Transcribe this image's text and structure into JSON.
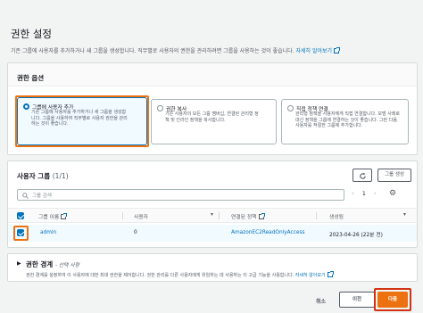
{
  "page": {
    "title": "권한 설정",
    "description": "기존 그룹에 사용자를 추가하거나 새 그룹을 생성합니다. 직무별로 사용자의 권한을 관리하려면 그룹을 사용하는 것이 좋습니다.",
    "learn_more": "자세히 알아보기"
  },
  "permission_options": {
    "header": "권한 옵션",
    "options": [
      {
        "label": "그룹에 사용자 추가",
        "desc": "기존 그룹에 사용자를 추가하거나 새 그룹을 생성합니다. 그룹을 사용하여 직무별로 사용자 권한을 관리하는 것이 좋습니다.",
        "selected": true
      },
      {
        "label": "권한 복사",
        "desc": "기존 사용자의 모든 그룹 멤버십, 연결된 관리형 정책 및 인라인 정책을 복사합니다.",
        "selected": false
      },
      {
        "label": "직접 정책 연결",
        "desc": "관리형 정책을 사용자에게 직접 연결합니다. 모범 사례로 대신 정책을 그룹에 연결하는 것이 좋습니다. 그런 다음 사용자를 적절한 그룹에 추가합니다.",
        "selected": false
      }
    ]
  },
  "user_groups": {
    "header": "사용자 그룹",
    "count": "(1/1)",
    "create_button": "그룹 생성",
    "search_placeholder": "그룹 검색",
    "page_number": "1",
    "columns": [
      "그룹 이름",
      "사용자",
      "연결된 정책",
      "생성됨"
    ],
    "rows": [
      {
        "name": "admin",
        "users": "0",
        "policy": "AmazonEC2ReadOnlyAccess",
        "created": "2023-04-26 (22분 전)",
        "checked": true
      }
    ]
  },
  "permissions_boundary": {
    "title": "권한 경계",
    "optional": "- 선택 사항",
    "desc": "권한 경계를 설정하여 이 사용자에 대한 최대 권한을 제어합니다. 권한 관리를 다른 사용자에게 위임하는 데 사용하는 이 고급 기능을 사용합니다.",
    "learn_more": "자세히 알아보기"
  },
  "footer": {
    "cancel": "취소",
    "previous": "이전",
    "next": "다음"
  },
  "colors": {
    "primary": "#ec7211",
    "link": "#0073bb",
    "highlight": "#d13212"
  }
}
